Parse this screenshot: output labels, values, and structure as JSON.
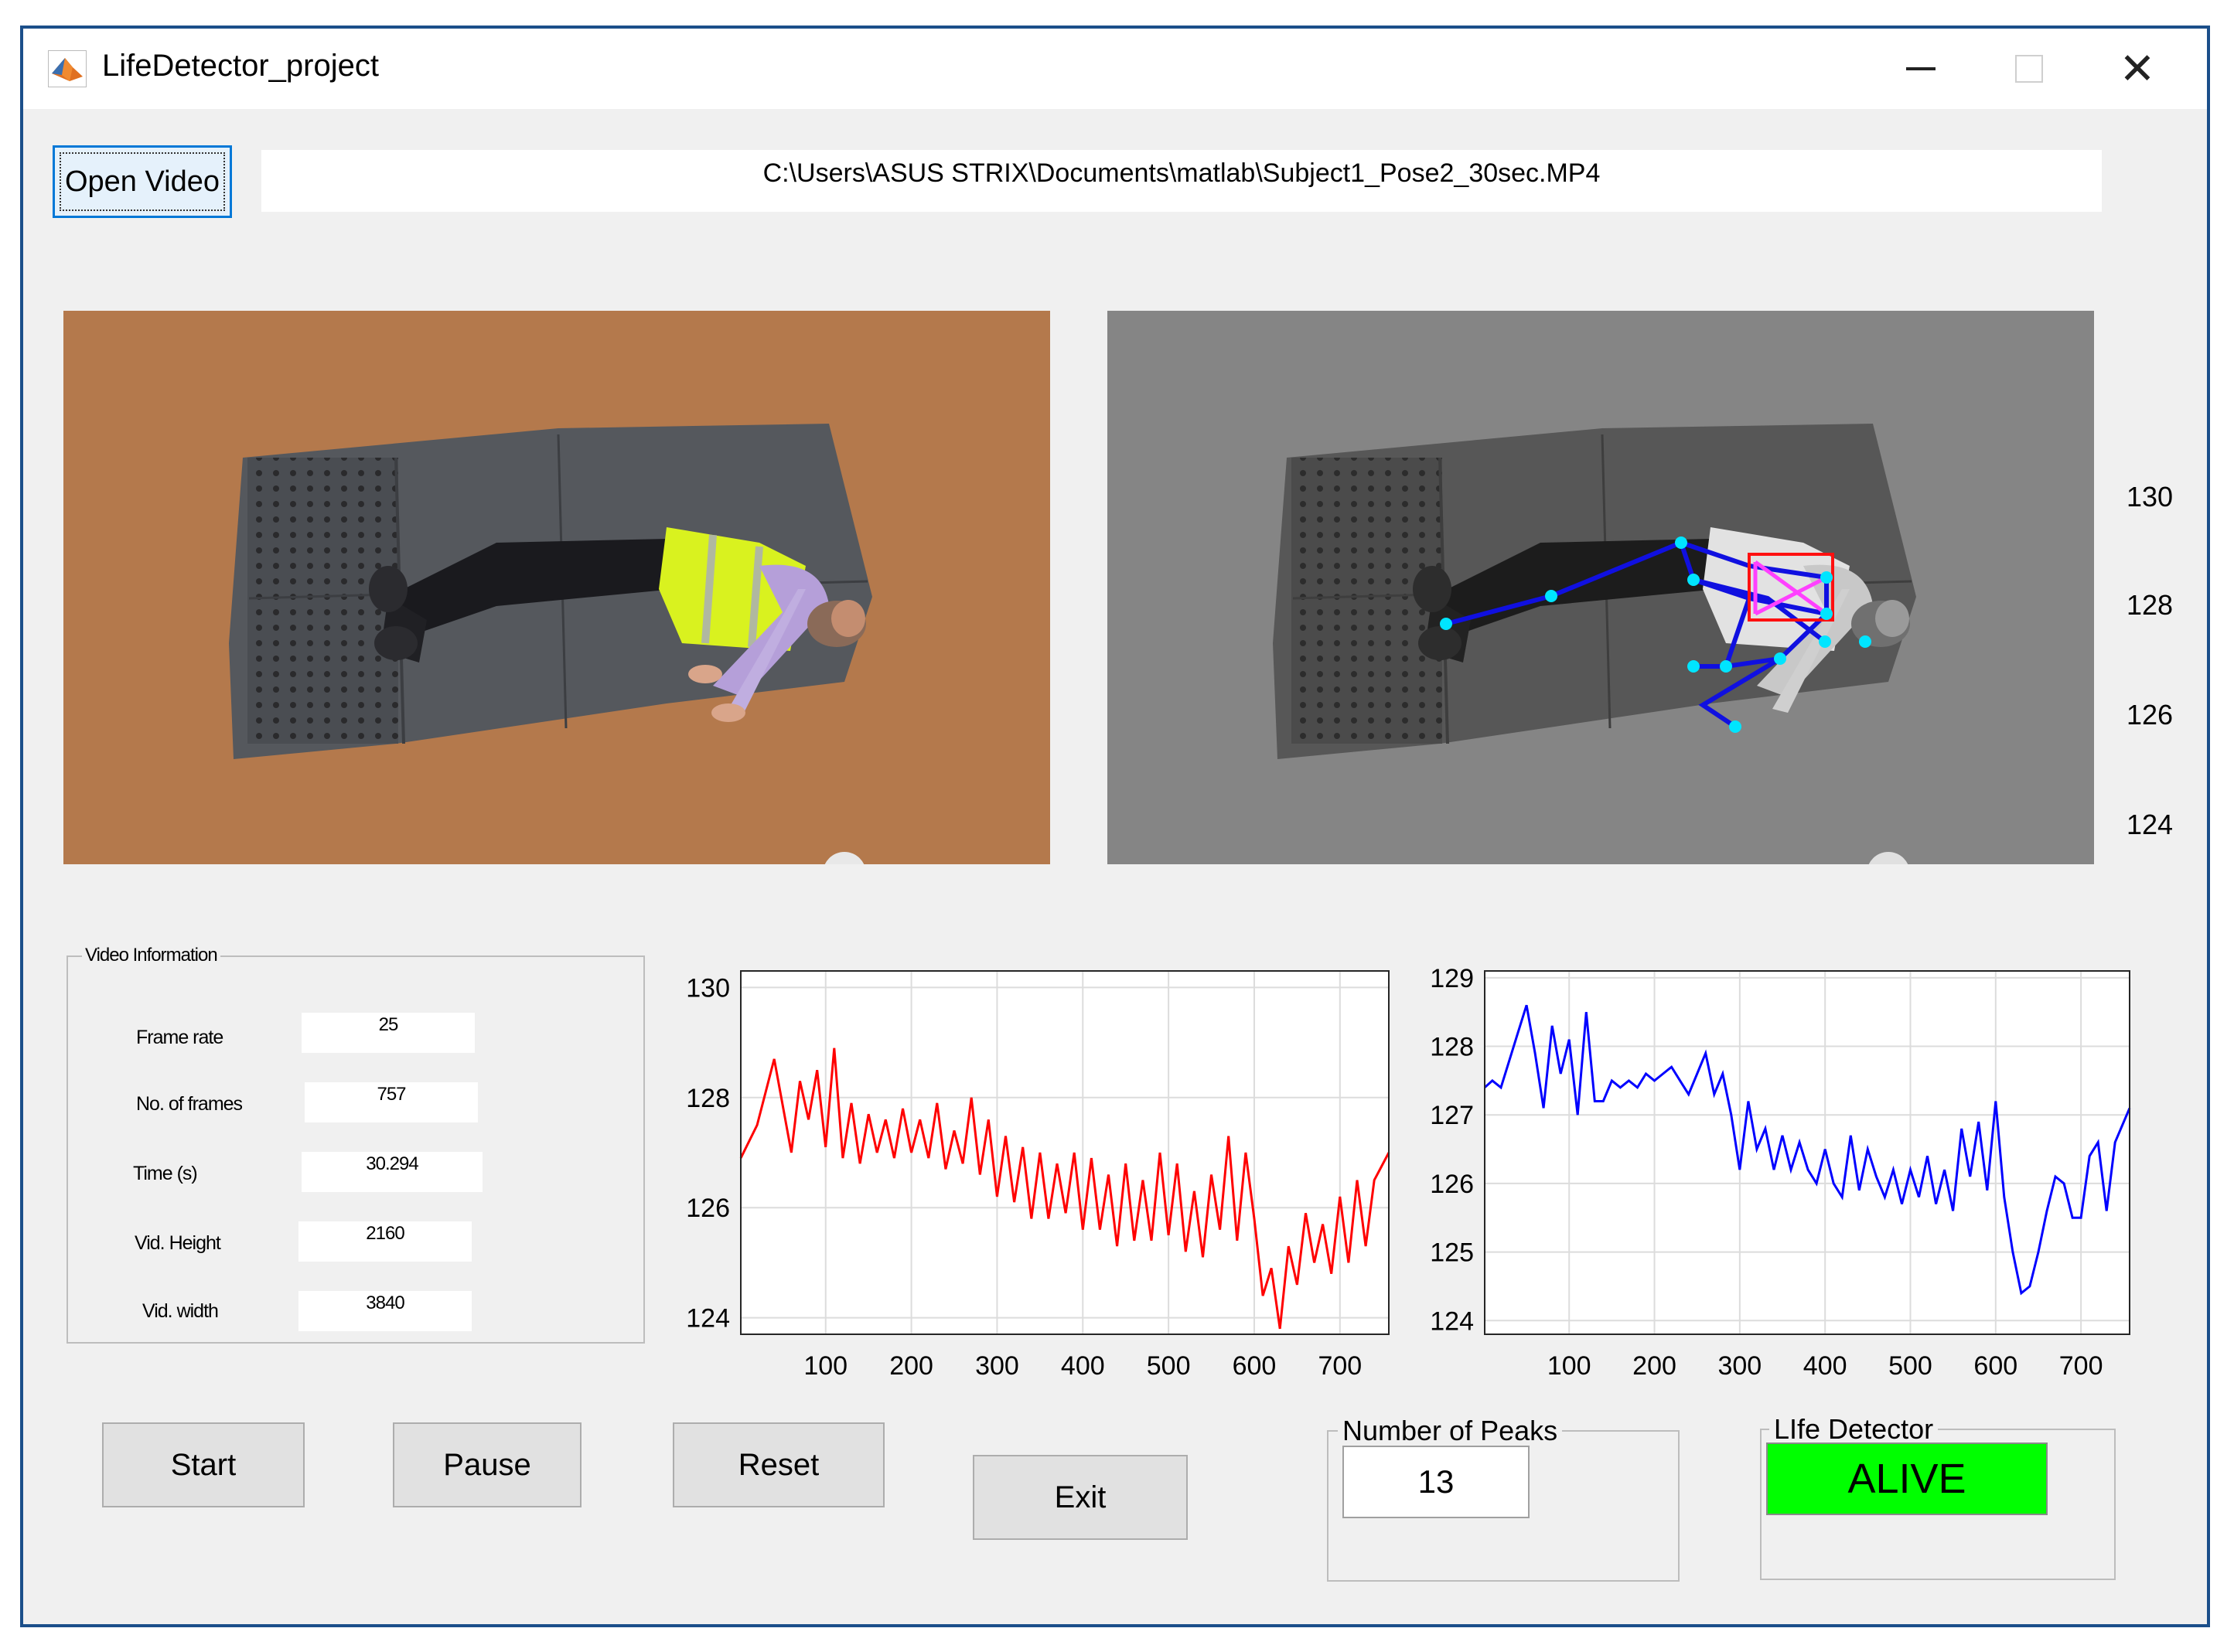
{
  "window": {
    "title": "LifeDetector_project",
    "icon": "matlab-icon"
  },
  "controls": {
    "open_video_label": "Open Video",
    "file_path": "C:\\Users\\ASUS STRIX\\Documents\\matlab\\Subject1_Pose2_30sec.MP4"
  },
  "views": {
    "right_axis_ticks": [
      "130",
      "128",
      "126",
      "124"
    ]
  },
  "video_info": {
    "title": "Video Information",
    "fields": [
      {
        "label": "Frame rate",
        "value": "25"
      },
      {
        "label": "No. of frames",
        "value": "757"
      },
      {
        "label": "Time (s)",
        "value": "30.294"
      },
      {
        "label": "Vid. Height",
        "value": "2160"
      },
      {
        "label": "Vid. width",
        "value": "3840"
      }
    ]
  },
  "buttons": {
    "start": "Start",
    "pause": "Pause",
    "reset": "Reset",
    "exit": "Exit"
  },
  "peaks": {
    "title": "Number of Peaks",
    "value": "13"
  },
  "detector": {
    "title": "LIfe Detector",
    "status": "ALIVE",
    "status_color": "#00ff00"
  },
  "chart_data": [
    {
      "type": "line",
      "color": "#ff0000",
      "xlim": [
        1,
        757
      ],
      "ylim": [
        123.7,
        130.3
      ],
      "xticks": [
        100,
        200,
        300,
        400,
        500,
        600,
        700
      ],
      "yticks": [
        124,
        126,
        128,
        130
      ],
      "grid": true,
      "series": [
        {
          "x": [
            1,
            20,
            40,
            60,
            70,
            80,
            90,
            100,
            110,
            120,
            130,
            140,
            150,
            160,
            170,
            180,
            190,
            200,
            210,
            220,
            230,
            240,
            250,
            260,
            270,
            280,
            290,
            300,
            310,
            320,
            330,
            340,
            350,
            360,
            370,
            380,
            390,
            400,
            410,
            420,
            430,
            440,
            450,
            460,
            470,
            480,
            490,
            500,
            510,
            520,
            530,
            540,
            550,
            560,
            570,
            580,
            590,
            600,
            610,
            620,
            630,
            640,
            650,
            660,
            670,
            680,
            690,
            700,
            710,
            720,
            730,
            740,
            757
          ],
          "y": [
            126.9,
            127.5,
            128.7,
            127.0,
            128.3,
            127.6,
            128.5,
            127.1,
            128.9,
            126.9,
            127.9,
            126.8,
            127.7,
            127.0,
            127.6,
            126.9,
            127.8,
            127.0,
            127.6,
            126.9,
            127.9,
            126.7,
            127.4,
            126.8,
            128.0,
            126.6,
            127.6,
            126.2,
            127.3,
            126.1,
            127.1,
            125.8,
            127.0,
            125.8,
            126.8,
            125.9,
            127.0,
            125.6,
            126.9,
            125.6,
            126.6,
            125.3,
            126.8,
            125.4,
            126.5,
            125.4,
            127.0,
            125.5,
            126.8,
            125.2,
            126.3,
            125.1,
            126.6,
            125.6,
            127.3,
            125.4,
            127.0,
            125.8,
            124.4,
            124.9,
            123.8,
            125.3,
            124.6,
            125.9,
            125.0,
            125.7,
            124.8,
            126.2,
            125.0,
            126.5,
            125.3,
            126.5,
            127.0
          ]
        }
      ]
    },
    {
      "type": "line",
      "color": "#0000ff",
      "xlim": [
        1,
        757
      ],
      "ylim": [
        123.8,
        129.1
      ],
      "xticks": [
        100,
        200,
        300,
        400,
        500,
        600,
        700
      ],
      "yticks": [
        124,
        125,
        126,
        127,
        128,
        129
      ],
      "grid": true,
      "series": [
        {
          "x": [
            1,
            10,
            20,
            30,
            40,
            50,
            60,
            70,
            80,
            90,
            100,
            110,
            120,
            130,
            140,
            150,
            160,
            170,
            180,
            190,
            200,
            210,
            220,
            230,
            240,
            250,
            260,
            270,
            280,
            290,
            300,
            310,
            320,
            330,
            340,
            350,
            360,
            370,
            380,
            390,
            400,
            410,
            420,
            430,
            440,
            450,
            460,
            470,
            480,
            490,
            500,
            510,
            520,
            530,
            540,
            550,
            560,
            570,
            580,
            590,
            600,
            610,
            620,
            630,
            640,
            650,
            660,
            670,
            680,
            690,
            700,
            710,
            720,
            730,
            740,
            757
          ],
          "y": [
            127.4,
            127.5,
            127.4,
            127.8,
            128.2,
            128.6,
            127.9,
            127.1,
            128.3,
            127.6,
            128.1,
            127.0,
            128.5,
            127.2,
            127.2,
            127.5,
            127.4,
            127.5,
            127.4,
            127.6,
            127.5,
            127.6,
            127.7,
            127.5,
            127.3,
            127.6,
            127.9,
            127.3,
            127.6,
            127.0,
            126.2,
            127.2,
            126.5,
            126.8,
            126.2,
            126.7,
            126.2,
            126.6,
            126.2,
            126.0,
            126.5,
            126.0,
            125.8,
            126.7,
            125.9,
            126.5,
            126.1,
            125.8,
            126.2,
            125.7,
            126.2,
            125.8,
            126.4,
            125.7,
            126.2,
            125.6,
            126.8,
            126.1,
            126.9,
            125.9,
            127.2,
            125.8,
            125.0,
            124.4,
            124.5,
            125.0,
            125.6,
            126.1,
            126.0,
            125.5,
            125.5,
            126.4,
            126.6,
            125.6,
            126.6,
            127.1
          ]
        }
      ]
    }
  ]
}
